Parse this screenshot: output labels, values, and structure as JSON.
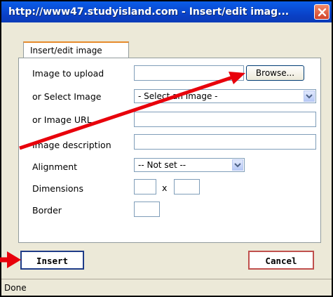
{
  "window": {
    "title": "http://www47.studyisland.com - Insert/edit imag..."
  },
  "tab": {
    "label": "Insert/edit image"
  },
  "form": {
    "image_to_upload_label": "Image to upload",
    "image_to_upload_value": "",
    "browse_label": "Browse...",
    "select_image_label": "or Select Image",
    "select_image_value": "- Select an Image -",
    "image_url_label": "or Image URL",
    "image_url_value": "",
    "description_label": "Image description",
    "description_value": "",
    "alignment_label": "Alignment",
    "alignment_value": "-- Not set --",
    "dimensions_label": "Dimensions",
    "dimensions_separator": "x",
    "width_value": "",
    "height_value": "",
    "border_label": "Border",
    "border_value": ""
  },
  "buttons": {
    "insert_label": "Insert",
    "cancel_label": "Cancel"
  },
  "status": {
    "text": "Done"
  },
  "colors": {
    "titlebar": "#0a47d4",
    "annotation_arrow": "#e8000b",
    "cancel_border": "#c0504d",
    "insert_border": "#1f3c88"
  },
  "icons": {
    "close": "close-icon",
    "dropdown": "chevron-down-icon"
  }
}
